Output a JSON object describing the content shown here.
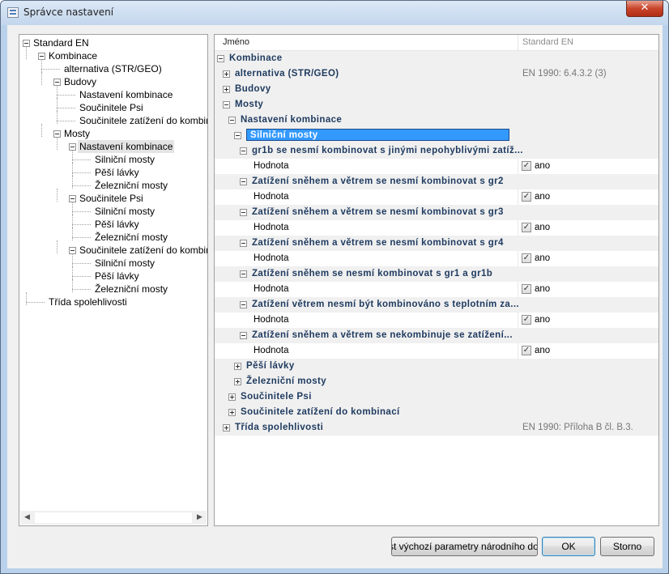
{
  "window": {
    "title": "Správce nastavení",
    "close_symbol": "✕"
  },
  "tree": {
    "items": [
      {
        "label": "Standard EN",
        "level": 0,
        "expander": "minus"
      },
      {
        "label": "Kombinace",
        "level": 1,
        "expander": "minus"
      },
      {
        "label": "alternativa (STR/GEO)",
        "level": 2,
        "expander": "none"
      },
      {
        "label": "Budovy",
        "level": 2,
        "expander": "minus"
      },
      {
        "label": "Nastavení kombinace",
        "level": 3,
        "expander": "none"
      },
      {
        "label": "Součinitele Psi",
        "level": 3,
        "expander": "none"
      },
      {
        "label": "Součinitele zatížení do kombinac",
        "level": 3,
        "expander": "none"
      },
      {
        "label": "Mosty",
        "level": 2,
        "expander": "minus"
      },
      {
        "label": "Nastavení kombinace",
        "level": 3,
        "expander": "minus",
        "selected": true
      },
      {
        "label": "Silniční mosty",
        "level": 4,
        "expander": "none"
      },
      {
        "label": "Pěší lávky",
        "level": 4,
        "expander": "none"
      },
      {
        "label": "Železniční mosty",
        "level": 4,
        "expander": "none"
      },
      {
        "label": "Součinitele Psi",
        "level": 3,
        "expander": "minus"
      },
      {
        "label": "Silniční mosty",
        "level": 4,
        "expander": "none"
      },
      {
        "label": "Pěší lávky",
        "level": 4,
        "expander": "none"
      },
      {
        "label": "Železniční mosty",
        "level": 4,
        "expander": "none"
      },
      {
        "label": "Součinitele zatížení do kombinac",
        "level": 3,
        "expander": "minus"
      },
      {
        "label": "Silniční mosty",
        "level": 4,
        "expander": "none"
      },
      {
        "label": "Pěší lávky",
        "level": 4,
        "expander": "none"
      },
      {
        "label": "Železniční mosty",
        "level": 4,
        "expander": "none"
      },
      {
        "label": "Třída spolehlivosti",
        "level": 1,
        "expander": "none"
      }
    ],
    "scroll_left": "◀",
    "scroll_right": "▶"
  },
  "grid": {
    "header": {
      "name": "Jméno",
      "standard": "Standard EN"
    },
    "rows": [
      {
        "label": "Kombinace",
        "level": 0,
        "expander": "minus",
        "kind": "cat",
        "std": ""
      },
      {
        "label": "alternativa (STR/GEO)",
        "level": 1,
        "expander": "plus",
        "kind": "cat",
        "std": "EN 1990: 6.4.3.2 (3)"
      },
      {
        "label": "Budovy",
        "level": 1,
        "expander": "plus",
        "kind": "cat",
        "std": ""
      },
      {
        "label": "Mosty",
        "level": 1,
        "expander": "minus",
        "kind": "cat",
        "std": ""
      },
      {
        "label": "Nastavení kombinace",
        "level": 2,
        "expander": "minus",
        "kind": "cat",
        "std": ""
      },
      {
        "label": "Silniční mosty",
        "level": 3,
        "expander": "minus",
        "kind": "cat",
        "selected": true,
        "std": ""
      },
      {
        "label": "gr1b se nesmí kombinovat s jinými nepohyblivými zatíž...",
        "level": 4,
        "expander": "minus",
        "kind": "cat",
        "std": ""
      },
      {
        "label": "Hodnota",
        "level": 4,
        "kind": "val",
        "checked": true,
        "value": "ano"
      },
      {
        "label": "Zatížení sněhem a větrem se nesmí kombinovat s gr2",
        "level": 4,
        "expander": "minus",
        "kind": "cat",
        "std": ""
      },
      {
        "label": "Hodnota",
        "level": 4,
        "kind": "val",
        "checked": true,
        "value": "ano"
      },
      {
        "label": "Zatížení sněhem a větrem se nesmí kombinovat s gr3",
        "level": 4,
        "expander": "minus",
        "kind": "cat",
        "std": ""
      },
      {
        "label": "Hodnota",
        "level": 4,
        "kind": "val",
        "checked": true,
        "value": "ano"
      },
      {
        "label": "Zatížení sněhem a větrem se nesmí kombinovat s gr4",
        "level": 4,
        "expander": "minus",
        "kind": "cat",
        "std": ""
      },
      {
        "label": "Hodnota",
        "level": 4,
        "kind": "val",
        "checked": true,
        "value": "ano"
      },
      {
        "label": "Zatížení sněhem se nesmí kombinovat s gr1 a gr1b",
        "level": 4,
        "expander": "minus",
        "kind": "cat",
        "std": ""
      },
      {
        "label": "Hodnota",
        "level": 4,
        "kind": "val",
        "checked": true,
        "value": "ano"
      },
      {
        "label": "Zatížení větrem nesmí být kombinováno s teplotním za...",
        "level": 4,
        "expander": "minus",
        "kind": "cat",
        "std": ""
      },
      {
        "label": "Hodnota",
        "level": 4,
        "kind": "val",
        "checked": true,
        "value": "ano"
      },
      {
        "label": "Zatížení sněhem a větrem se nekombinuje se zatížení...",
        "level": 4,
        "expander": "minus",
        "kind": "cat",
        "std": ""
      },
      {
        "label": "Hodnota",
        "level": 4,
        "kind": "val",
        "checked": true,
        "value": "ano"
      },
      {
        "label": "Pěší lávky",
        "level": 3,
        "expander": "plus",
        "kind": "cat",
        "std": ""
      },
      {
        "label": "Železniční mosty",
        "level": 3,
        "expander": "plus",
        "kind": "cat",
        "std": ""
      },
      {
        "label": "Součinitele Psi",
        "level": 2,
        "expander": "plus",
        "kind": "cat",
        "std": ""
      },
      {
        "label": "Součinitele zatížení do kombinací",
        "level": 2,
        "expander": "plus",
        "kind": "cat",
        "std": ""
      },
      {
        "label": "Třída spolehlivosti",
        "level": 1,
        "expander": "plus",
        "kind": "cat",
        "std": "EN 1990: Příloha B čl. B.3."
      }
    ]
  },
  "buttons": {
    "load_defaults": "Číst výchozí parametry národního dokumentu",
    "ok": "OK",
    "cancel": "Storno"
  },
  "colors": {
    "selection": "#3399ff",
    "category_row": "#f0f0f0",
    "window_frame": "#b9d1ea"
  }
}
